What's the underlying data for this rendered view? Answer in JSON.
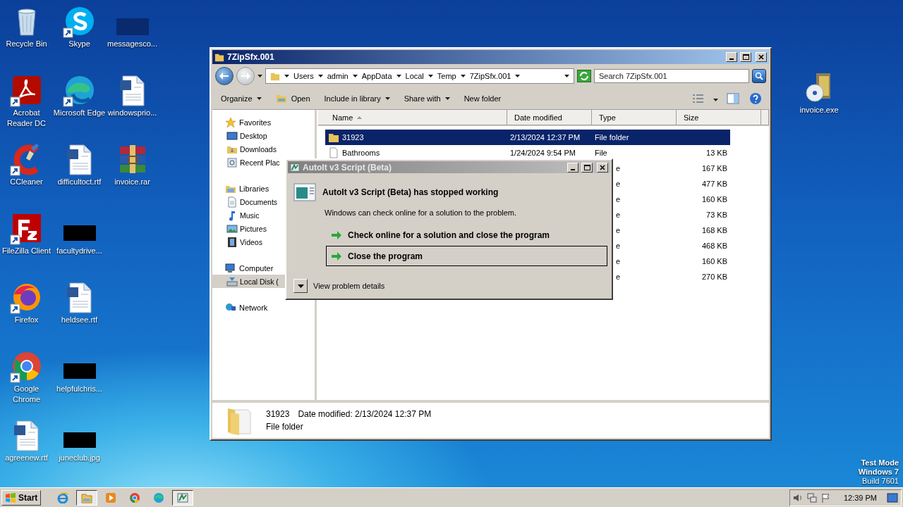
{
  "desktop_icons": [
    {
      "lines": [
        "Recycle Bin"
      ],
      "kind": "recycle",
      "shortcut": false
    },
    {
      "lines": [
        "Acrobat",
        "Reader DC"
      ],
      "kind": "acrobat",
      "shortcut": true
    },
    {
      "lines": [
        "CCleaner"
      ],
      "kind": "ccleaner",
      "shortcut": true
    },
    {
      "lines": [
        "FileZilla Client"
      ],
      "kind": "filezilla",
      "shortcut": true
    },
    {
      "lines": [
        "Firefox"
      ],
      "kind": "firefox",
      "shortcut": true
    },
    {
      "lines": [
        "Google",
        "Chrome"
      ],
      "kind": "chrome",
      "shortcut": true
    },
    {
      "lines": [
        "agreenew.rtf"
      ],
      "kind": "word",
      "shortcut": false
    },
    {
      "lines": [
        "Skype"
      ],
      "kind": "skype",
      "shortcut": true
    },
    {
      "lines": [
        "Microsoft Edge"
      ],
      "kind": "edge",
      "shortcut": true
    },
    {
      "lines": [
        "difficultoct.rtf"
      ],
      "kind": "word",
      "shortcut": false
    },
    {
      "lines": [
        "facultydrive..."
      ],
      "kind": "redacted",
      "shortcut": false
    },
    {
      "lines": [
        "heldsee.rtf"
      ],
      "kind": "word",
      "shortcut": false
    },
    {
      "lines": [
        "helpfulchris..."
      ],
      "kind": "redacted",
      "shortcut": false
    },
    {
      "lines": [
        "juneclub.jpg"
      ],
      "kind": "redacted",
      "shortcut": false
    },
    {
      "lines": [
        "messagesco..."
      ],
      "kind": "dark",
      "shortcut": false
    },
    {
      "lines": [
        "windowsprio..."
      ],
      "kind": "word",
      "shortcut": false
    },
    {
      "lines": [
        "invoice.rar"
      ],
      "kind": "rar",
      "shortcut": false
    }
  ],
  "right_icon": {
    "lines": [
      "invoice.exe"
    ],
    "kind": "exe",
    "shortcut": false
  },
  "explorer": {
    "title": "7ZipSfx.001",
    "breadcrumb": [
      "Users",
      "admin",
      "AppData",
      "Local",
      "Temp",
      "7ZipSfx.001"
    ],
    "search": {
      "placeholder": "Search 7ZipSfx.001"
    },
    "toolbar": [
      {
        "label": "Organize",
        "kind": "menu"
      },
      {
        "label": "Open",
        "kind": "open"
      },
      {
        "label": "Include in library",
        "kind": "menu"
      },
      {
        "label": "Share with",
        "kind": "menu"
      },
      {
        "label": "New folder",
        "kind": "plain"
      }
    ],
    "nav": [
      {
        "label": "Favorites",
        "kind": "star",
        "selected": false,
        "children": [
          {
            "label": "Desktop",
            "kind": "desktop",
            "selected": false
          },
          {
            "label": "Downloads",
            "kind": "folder",
            "selected": false
          },
          {
            "label": "Recent Plac",
            "kind": "recent",
            "selected": false
          }
        ]
      },
      {
        "label": "Libraries",
        "kind": "library",
        "selected": false,
        "children": [
          {
            "label": "Documents",
            "kind": "doc",
            "selected": false
          },
          {
            "label": "Music",
            "kind": "music",
            "selected": false
          },
          {
            "label": "Pictures",
            "kind": "pictures",
            "selected": false
          },
          {
            "label": "Videos",
            "kind": "videos",
            "selected": false
          }
        ]
      },
      {
        "label": "Computer",
        "kind": "computer",
        "selected": false,
        "children": [
          {
            "label": "Local Disk (",
            "kind": "disk",
            "selected": true
          }
        ]
      },
      {
        "label": "Network",
        "kind": "network",
        "selected": false
      }
    ],
    "columns": [
      "Name",
      "Date modified",
      "Type",
      "Size"
    ],
    "rows": [
      {
        "kind": "folder",
        "name": "31923",
        "date": "2/13/2024 12:37 PM",
        "type": "File folder",
        "selected": true
      },
      {
        "kind": "file",
        "name": "Bathrooms",
        "date": "1/24/2024 9:54 PM",
        "type": "File",
        "size": "13 KB",
        "selected": false
      },
      {
        "kind": "covered",
        "type": "e",
        "size": "167 KB",
        "selected": false
      },
      {
        "kind": "covered",
        "type": "e",
        "size": "477 KB",
        "selected": false
      },
      {
        "kind": "covered",
        "type": "e",
        "size": "160 KB",
        "selected": false
      },
      {
        "kind": "covered",
        "type": "e",
        "size": "73 KB",
        "selected": false
      },
      {
        "kind": "covered",
        "type": "e",
        "size": "168 KB",
        "selected": false
      },
      {
        "kind": "covered",
        "type": "e",
        "size": "468 KB",
        "selected": false
      },
      {
        "kind": "covered",
        "type": "e",
        "size": "160 KB",
        "selected": false
      },
      {
        "kind": "covered",
        "type": "e",
        "size": "270 KB",
        "selected": false
      }
    ],
    "details": {
      "name": "31923",
      "date_label": "Date modified:",
      "date": "2/13/2024 12:37 PM",
      "type": "File folder"
    }
  },
  "dialog": {
    "title": "AutoIt v3 Script (Beta)",
    "heading": "AutoIt v3 Script (Beta) has stopped working",
    "message": "Windows can check online for a solution to the problem.",
    "options": [
      {
        "label": "Check online for a solution and close the program",
        "selected": false
      },
      {
        "label": "Close the program",
        "selected": true
      }
    ],
    "details_toggle": "View problem details"
  },
  "os_notice": [
    "Test Mode",
    "Windows 7",
    "Build 7601"
  ],
  "taskbar": {
    "start": "Start",
    "apps": [
      {
        "kind": "ie",
        "active": false
      },
      {
        "kind": "explorer",
        "active": true
      },
      {
        "kind": "media",
        "active": false
      },
      {
        "kind": "chrome",
        "active": false
      },
      {
        "kind": "edge",
        "active": false
      },
      {
        "kind": "autoit",
        "active": true
      }
    ],
    "clock": "12:39 PM"
  }
}
